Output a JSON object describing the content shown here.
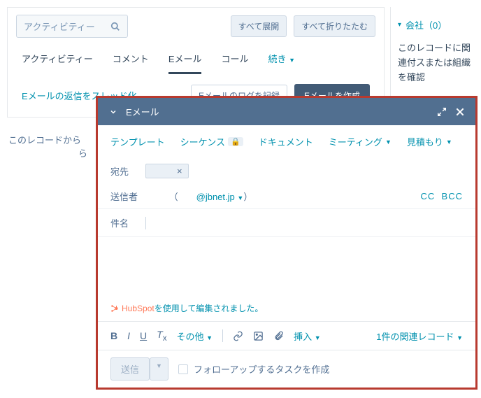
{
  "bg": {
    "search_placeholder": "アクティビティー",
    "expand_all": "すべて展開",
    "collapse_all": "すべて折りたたむ",
    "tabs": [
      "アクティビティー",
      "コメント",
      "Eメール",
      "コール",
      "続き"
    ],
    "active_tab_index": 2,
    "thread_link": "Eメールの返信をスレッド化",
    "log_label": "Eメールのログを記録",
    "create_label": "Eメールを作成",
    "empty_note": "このレコードから",
    "empty_note2": "ら"
  },
  "right": {
    "title": "会社（0）",
    "desc": "このレコードに関連付スまたは組織を確認"
  },
  "modal": {
    "title": "Eメール",
    "toolbar": {
      "template": "テンプレート",
      "sequence": "シーケンス",
      "document": "ドキュメント",
      "meeting": "ミーティング",
      "quote": "見積もり"
    },
    "to_label": "宛先",
    "chip_x": "×",
    "from_label": "送信者",
    "from_paren_open": "（",
    "from_domain": "@jbnet.jp",
    "from_paren_close": "）",
    "cc": "CC",
    "bcc": "BCC",
    "subject_label": "件名",
    "branding_prefix": "HubSpot",
    "branding_suffix": "を使用して編集されました。",
    "format": {
      "more": "その他",
      "insert": "挿入",
      "assoc": "1件の関連レコード"
    },
    "footer": {
      "send": "送信",
      "followup": "フォローアップするタスクを作成"
    }
  }
}
